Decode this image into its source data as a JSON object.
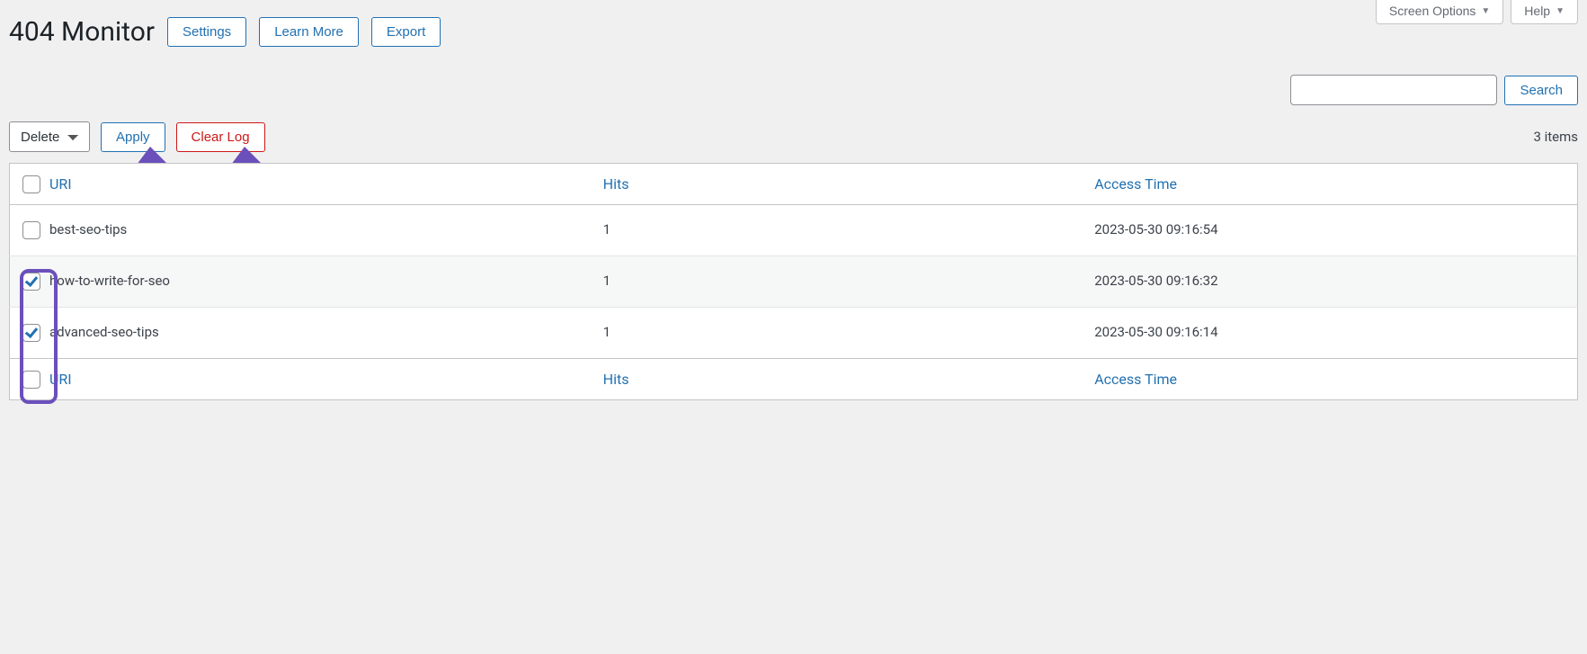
{
  "topButtons": {
    "screenOptions": "Screen Options",
    "help": "Help"
  },
  "page": {
    "title": "404 Monitor"
  },
  "headerButtons": {
    "settings": "Settings",
    "learnMore": "Learn More",
    "export": "Export"
  },
  "search": {
    "value": "",
    "button": "Search"
  },
  "bulk": {
    "selected": "Delete",
    "apply": "Apply",
    "clearLog": "Clear Log"
  },
  "itemsCount": "3 items",
  "columns": {
    "uri": "URI",
    "hits": "Hits",
    "accessTime": "Access Time"
  },
  "rows": [
    {
      "checked": false,
      "uri": "best-seo-tips",
      "hits": "1",
      "accessTime": "2023-05-30 09:16:54"
    },
    {
      "checked": true,
      "uri": "how-to-write-for-seo",
      "hits": "1",
      "accessTime": "2023-05-30 09:16:32"
    },
    {
      "checked": true,
      "uri": "advanced-seo-tips",
      "hits": "1",
      "accessTime": "2023-05-30 09:16:14"
    }
  ]
}
